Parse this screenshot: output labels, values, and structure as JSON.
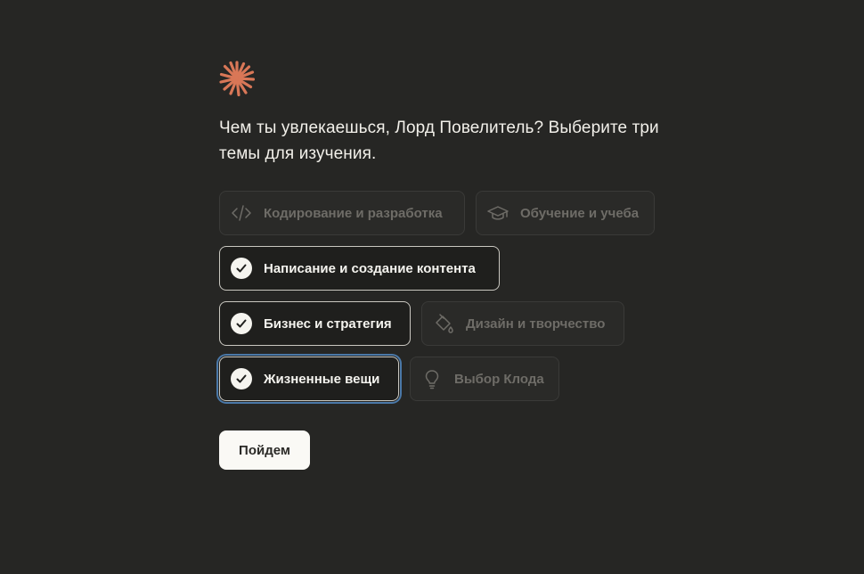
{
  "prompt": {
    "question": "Чем ты увлекаешься, Лорд Повелитель? Выберите три темы для изучения."
  },
  "colors": {
    "accent": "#d97757",
    "background": "#262624",
    "focus_ring": "#4a78a8"
  },
  "topics": [
    {
      "label": "Кодирование и разработка",
      "icon": "code-icon",
      "selected": false
    },
    {
      "label": "Обучение и учеба",
      "icon": "graduation-cap-icon",
      "selected": false
    },
    {
      "label": "Написание и создание контента",
      "icon": "check-icon",
      "selected": true
    },
    {
      "label": "Бизнес и стратегия",
      "icon": "check-icon",
      "selected": true
    },
    {
      "label": "Дизайн и творчество",
      "icon": "paint-bucket-icon",
      "selected": false
    },
    {
      "label": "Жизненные вещи",
      "icon": "check-icon",
      "selected": true,
      "focused": true
    },
    {
      "label": "Выбор Клода",
      "icon": "lightbulb-icon",
      "selected": false
    }
  ],
  "actions": {
    "continue_label": "Пойдем"
  }
}
